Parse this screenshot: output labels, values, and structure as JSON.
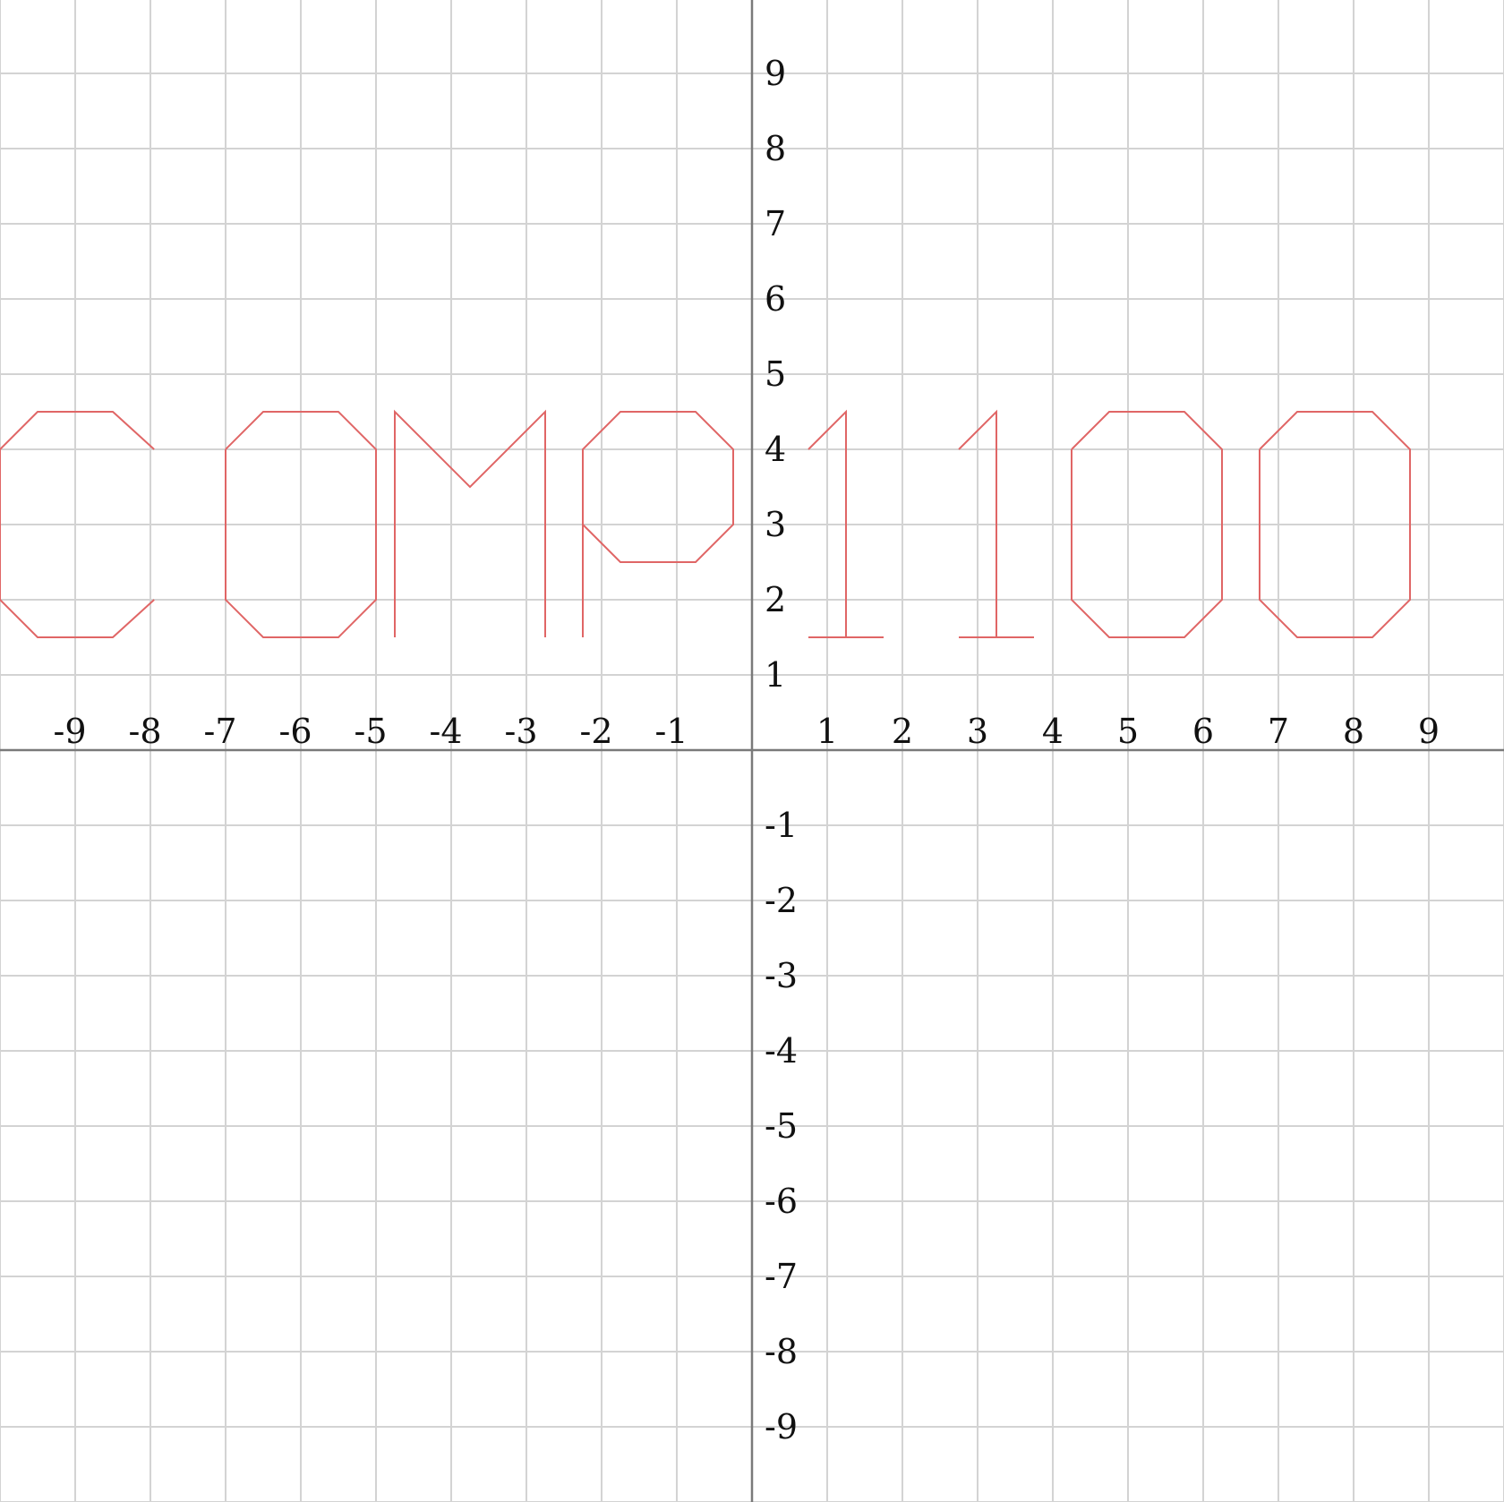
{
  "chart_data": {
    "type": "line",
    "title": "",
    "xlabel": "",
    "ylabel": "",
    "xlim": [
      -10,
      10
    ],
    "ylim": [
      -10,
      10
    ],
    "grid": true,
    "grid_step": 1,
    "x_ticks": [
      "-9",
      "-8",
      "-7",
      "-6",
      "-5",
      "-4",
      "-3",
      "-2",
      "-1",
      "1",
      "2",
      "3",
      "4",
      "5",
      "6",
      "7",
      "8",
      "9"
    ],
    "y_ticks": [
      "9",
      "8",
      "7",
      "6",
      "5",
      "4",
      "3",
      "2",
      "1",
      "-1",
      "-2",
      "-3",
      "-4",
      "-5",
      "-6",
      "-7",
      "-8",
      "-9"
    ],
    "colors": {
      "series": "#e06666",
      "grid": "#d3d3d3",
      "axis": "#7a7a7a"
    },
    "series": [
      {
        "points": [
          [
            -7.95,
            4
          ],
          [
            -8.5,
            4.5
          ],
          [
            -9.5,
            4.5
          ],
          [
            -10,
            4
          ],
          [
            -10,
            2
          ],
          [
            -9.5,
            1.5
          ],
          [
            -8.5,
            1.5
          ],
          [
            -7.95,
            2
          ]
        ]
      },
      {
        "points": [
          [
            -7,
            4
          ],
          [
            -6.5,
            4.5
          ],
          [
            -5.5,
            4.5
          ],
          [
            -5,
            4
          ],
          [
            -5,
            2
          ],
          [
            -5.5,
            1.5
          ],
          [
            -6.5,
            1.5
          ],
          [
            -7,
            2
          ],
          [
            -7,
            4
          ]
        ]
      },
      {
        "points": [
          [
            -4.75,
            1.5
          ],
          [
            -4.75,
            4.5
          ],
          [
            -3.75,
            3.5
          ],
          [
            -2.75,
            4.5
          ],
          [
            -2.75,
            1.5
          ]
        ]
      },
      {
        "points": [
          [
            -2.25,
            1.5
          ],
          [
            -2.25,
            4
          ],
          [
            -1.75,
            4.5
          ],
          [
            -0.75,
            4.5
          ],
          [
            -0.25,
            4
          ],
          [
            -0.25,
            3
          ],
          [
            -0.75,
            2.5
          ],
          [
            -1.75,
            2.5
          ],
          [
            -2.25,
            3
          ]
        ]
      },
      {
        "points": [
          [
            0.75,
            4
          ],
          [
            1.25,
            4.5
          ],
          [
            1.25,
            1.5
          ]
        ]
      },
      {
        "points": [
          [
            0.75,
            1.5
          ],
          [
            1.75,
            1.5
          ]
        ]
      },
      {
        "points": [
          [
            2.75,
            4
          ],
          [
            3.25,
            4.5
          ],
          [
            3.25,
            1.5
          ]
        ]
      },
      {
        "points": [
          [
            2.75,
            1.5
          ],
          [
            3.75,
            1.5
          ]
        ]
      },
      {
        "points": [
          [
            4.25,
            4
          ],
          [
            4.75,
            4.5
          ],
          [
            5.75,
            4.5
          ],
          [
            6.25,
            4
          ],
          [
            6.25,
            2
          ],
          [
            5.75,
            1.5
          ],
          [
            4.75,
            1.5
          ],
          [
            4.25,
            2
          ],
          [
            4.25,
            4
          ]
        ]
      },
      {
        "points": [
          [
            6.75,
            4
          ],
          [
            7.25,
            4.5
          ],
          [
            8.25,
            4.5
          ],
          [
            8.75,
            4
          ],
          [
            8.75,
            2
          ],
          [
            8.25,
            1.5
          ],
          [
            7.25,
            1.5
          ],
          [
            6.75,
            2
          ],
          [
            6.75,
            4
          ]
        ]
      }
    ]
  }
}
